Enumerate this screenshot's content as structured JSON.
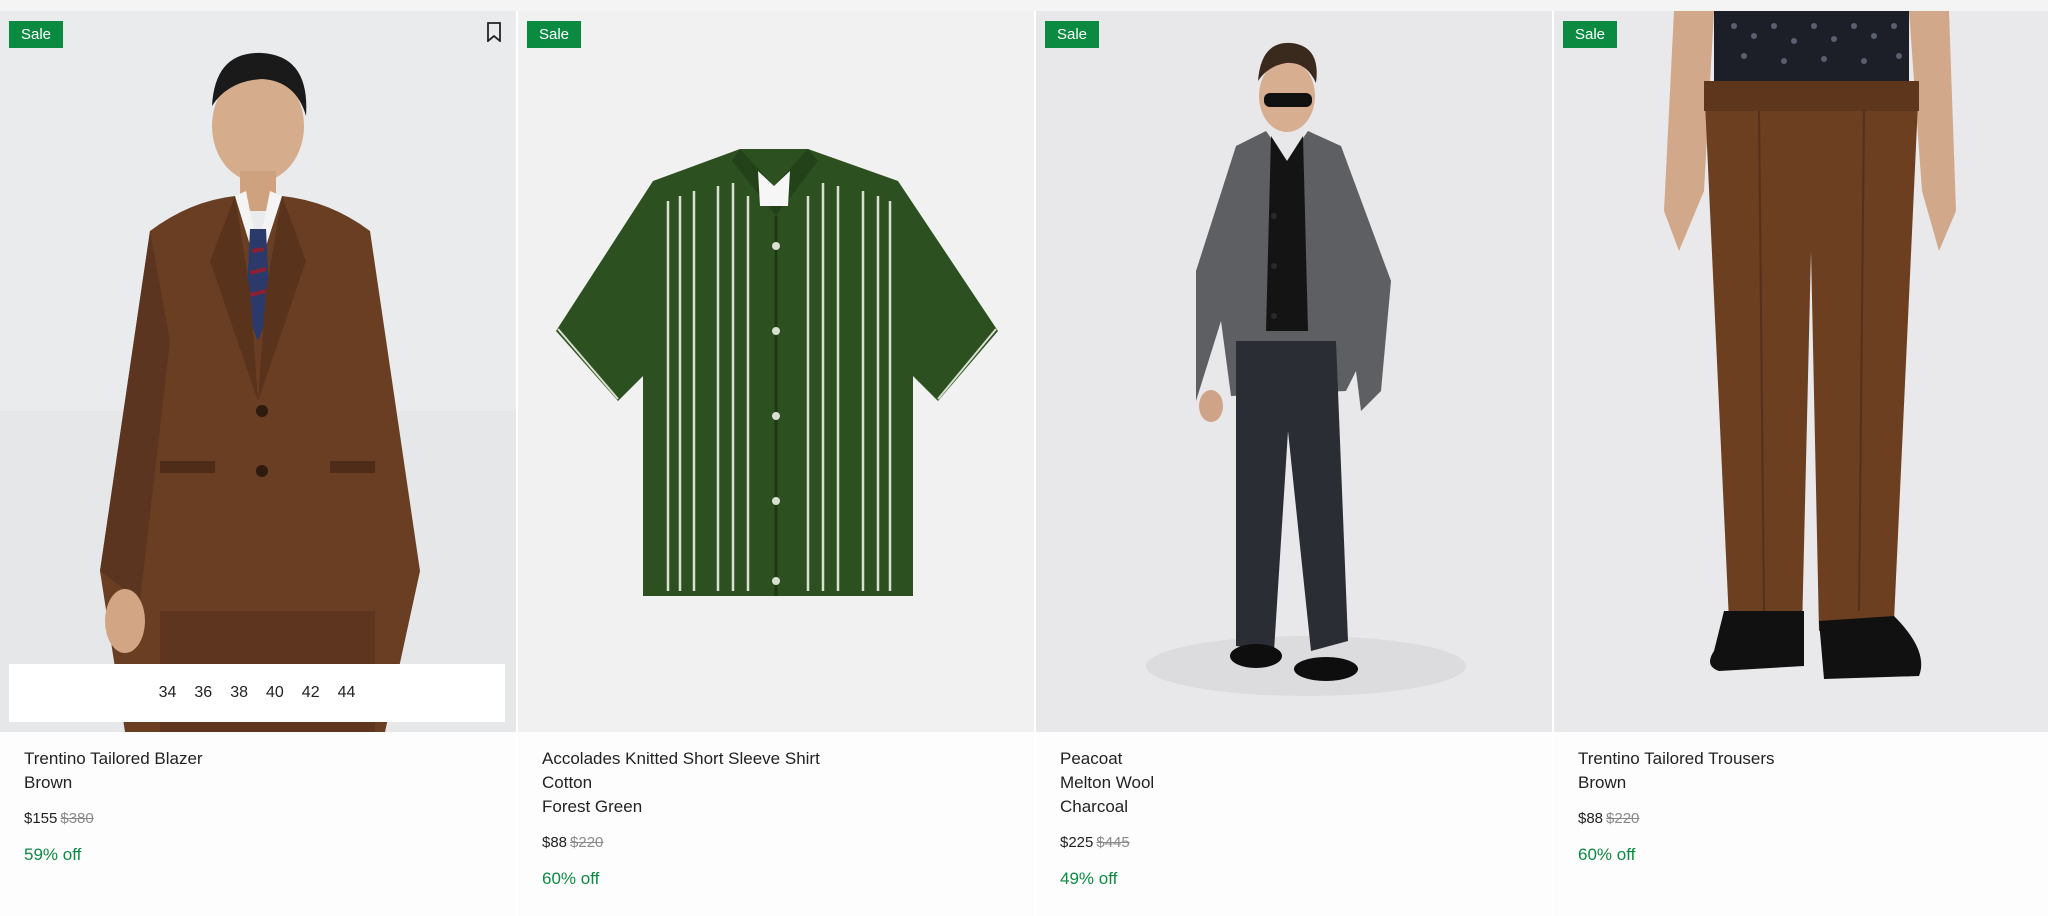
{
  "products": [
    {
      "badge": "Sale",
      "name": "Trentino Tailored Blazer",
      "details": [
        "Brown"
      ],
      "price": "$155",
      "original_price": "$380",
      "discount": "59% off",
      "sizes": [
        "34",
        "36",
        "38",
        "40",
        "42",
        "44"
      ]
    },
    {
      "badge": "Sale",
      "name": "Accolades Knitted Short Sleeve Shirt",
      "details": [
        "Cotton",
        "Forest Green"
      ],
      "price": "$88",
      "original_price": "$220",
      "discount": "60% off"
    },
    {
      "badge": "Sale",
      "name": "Peacoat",
      "details": [
        "Melton Wool",
        "Charcoal"
      ],
      "price": "$225",
      "original_price": "$445",
      "discount": "49% off"
    },
    {
      "badge": "Sale",
      "name": "Trentino Tailored Trousers",
      "details": [
        "Brown"
      ],
      "price": "$88",
      "original_price": "$220",
      "discount": "60% off"
    }
  ],
  "icons": {
    "bookmark": "bookmark-icon"
  },
  "colors": {
    "sale_badge": "#0b8a42",
    "discount_text": "#0b8a42"
  }
}
